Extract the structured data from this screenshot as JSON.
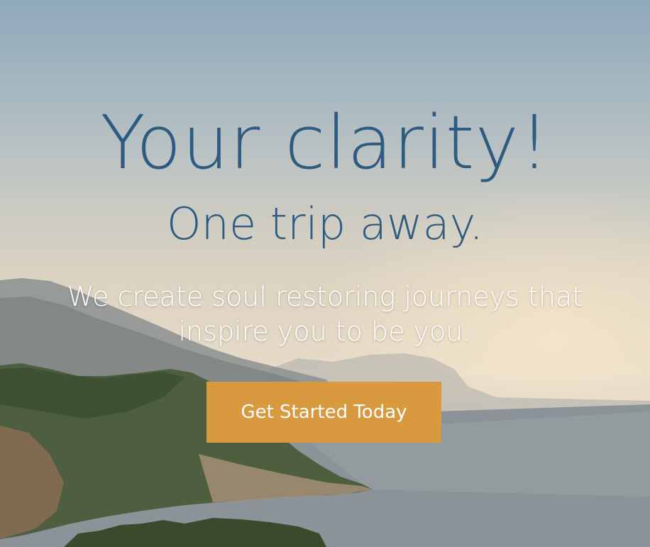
{
  "hero": {
    "title": "Your clarity!",
    "subtitle": "One trip away.",
    "tagline": "We create soul restoring journeys that inspire you to be you.",
    "cta_label": "Get Started Today"
  },
  "colors": {
    "heading": "#2f5b80",
    "button": "#d99a3f",
    "button_text": "#ffffff",
    "tagline": "#ffffff"
  }
}
